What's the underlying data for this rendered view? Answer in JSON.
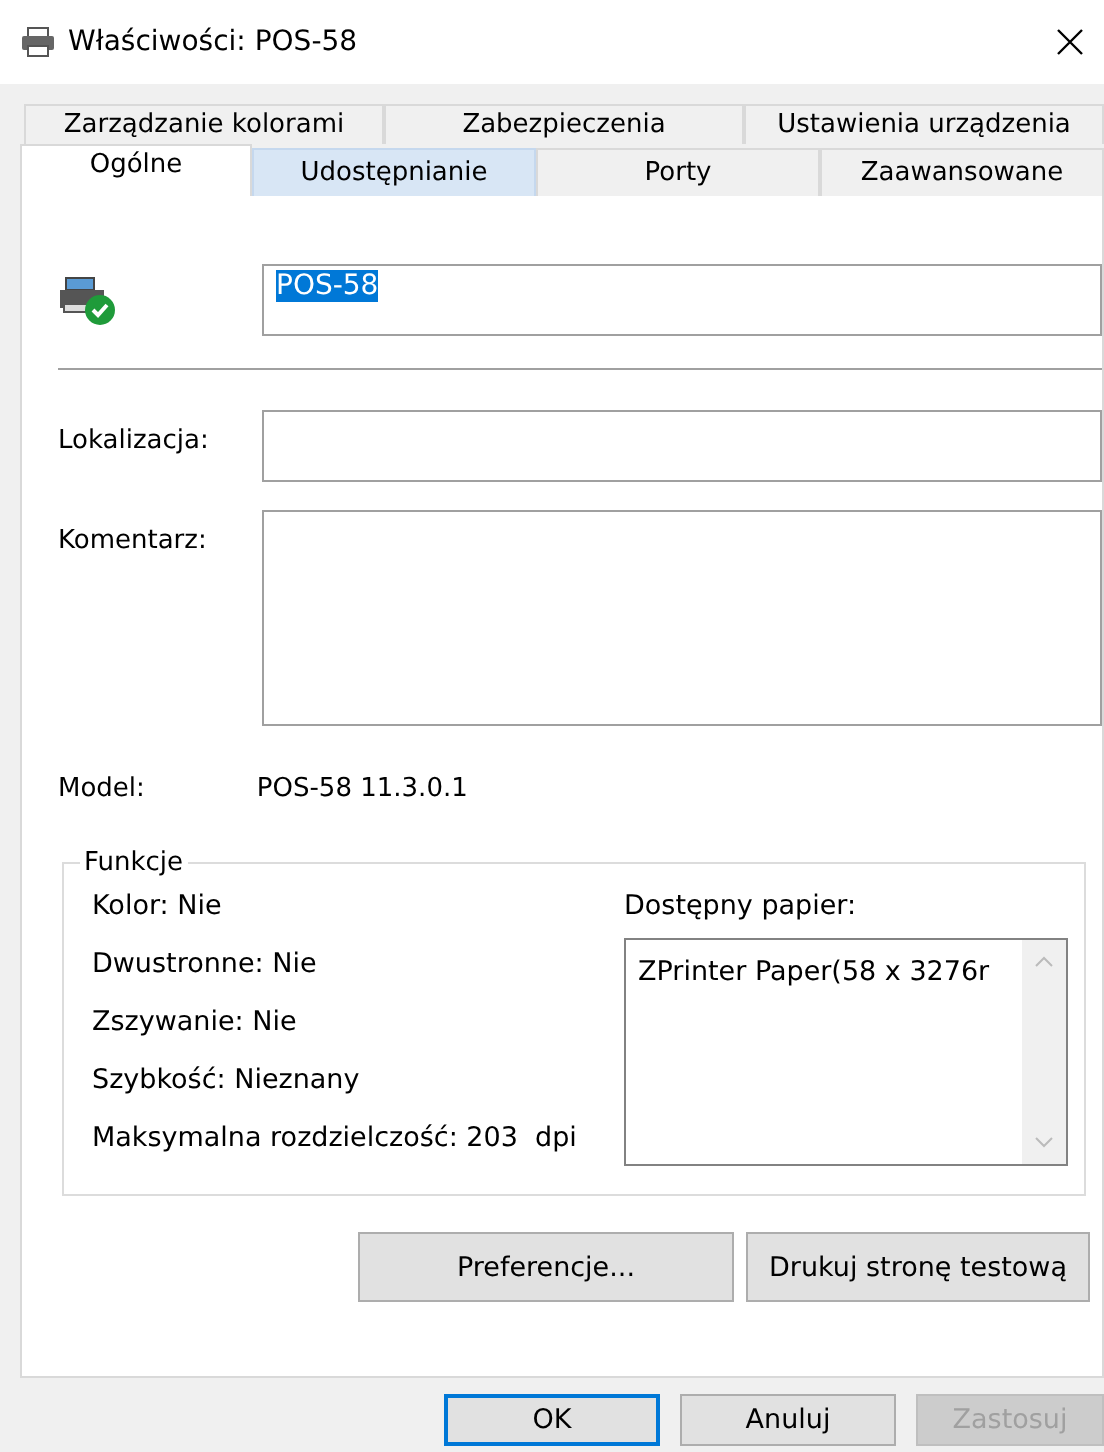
{
  "window": {
    "title": "Właściwości: POS-58"
  },
  "tab_rows": [
    [
      {
        "label": "Zarządzanie kolorami",
        "selected": false,
        "hovered": false
      },
      {
        "label": "Zabezpieczenia",
        "selected": false,
        "hovered": false
      },
      {
        "label": "Ustawienia urządzenia",
        "selected": false,
        "hovered": false
      }
    ],
    [
      {
        "label": "Ogólne",
        "selected": true,
        "hovered": false
      },
      {
        "label": "Udostępnianie",
        "selected": false,
        "hovered": true
      },
      {
        "label": "Porty",
        "selected": false,
        "hovered": false
      },
      {
        "label": "Zaawansowane",
        "selected": false,
        "hovered": false
      }
    ]
  ],
  "printer_name": {
    "value": "POS-58",
    "text_selected": true
  },
  "location": {
    "label": "Lokalizacja:"
  },
  "comment": {
    "label": "Komentarz:"
  },
  "model": {
    "label": "Model:",
    "value": "POS-58 11.3.0.1"
  },
  "features": {
    "title": "Funkcje",
    "items": [
      "Kolor: Nie",
      "Dwustronne: Nie",
      "Zszywanie: Nie",
      "Szybkość: Nieznany",
      "Maksymalna rozdzielczość: 203  dpi"
    ],
    "paper_label": "Dostępny papier:",
    "paper_items": [
      "ZPrinter Paper(58 x 3276r"
    ]
  },
  "panel_buttons": [
    {
      "label": "Preferencje..."
    },
    {
      "label": "Drukuj stronę testową"
    }
  ],
  "dialog_buttons": [
    {
      "label": "OK",
      "default": true,
      "disabled": false
    },
    {
      "label": "Anuluj",
      "default": false,
      "disabled": false
    },
    {
      "label": "Zastosuj",
      "default": false,
      "disabled": true
    }
  ]
}
